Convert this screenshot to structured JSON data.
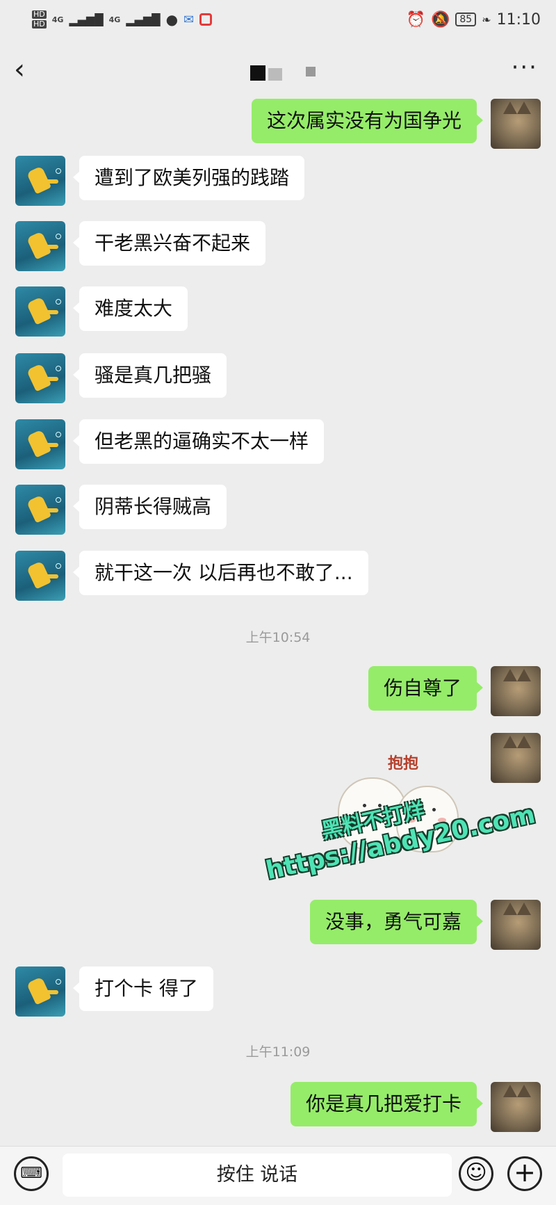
{
  "status_bar": {
    "hd1": "HD",
    "hd2": "HD",
    "sig1": "4G",
    "sig2": "4G",
    "battery": "85",
    "time": "11:10"
  },
  "chat": {
    "back_icon": "back-arrow-icon",
    "more_icon": "more-dots-icon"
  },
  "messages": [
    {
      "side": "out",
      "text": "这次属实没有为国争光"
    },
    {
      "side": "in",
      "text": "遭到了欧美列强的践踏"
    },
    {
      "side": "in",
      "text": "干老黑兴奋不起来"
    },
    {
      "side": "in",
      "text": "难度太大"
    },
    {
      "side": "in",
      "text": "骚是真几把骚"
    },
    {
      "side": "in",
      "text": "但老黑的逼确实不太一样"
    },
    {
      "side": "in",
      "text": "阴蒂长得贼高"
    },
    {
      "side": "in",
      "text": "就干这一次 以后再也不敢了..."
    },
    {
      "side": "out",
      "text": "伤自尊了"
    },
    {
      "side": "out",
      "text": "没事，勇气可嘉"
    },
    {
      "side": "in",
      "text": "打个卡 得了"
    },
    {
      "side": "out",
      "text": "你是真几把爱打卡"
    }
  ],
  "timestamps": [
    "上午10:54",
    "上午11:09"
  ],
  "sticker": {
    "text": "抱抱"
  },
  "watermark": {
    "line1": "黑料不打烊",
    "line2": "https://abdy20.com"
  },
  "input_bar": {
    "voice_label": "按住 说话"
  }
}
